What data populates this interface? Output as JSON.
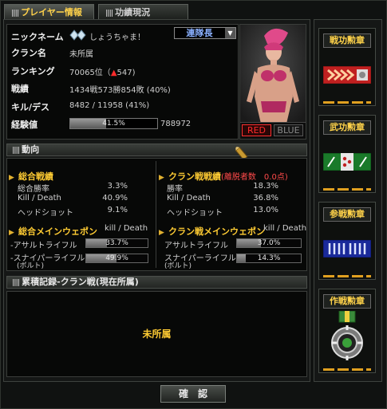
{
  "tabs": [
    {
      "label": "プレイヤー情報"
    },
    {
      "label": "功績現況"
    }
  ],
  "profile": {
    "nickname_label": "ニックネーム",
    "nickname": "しょうちゃま！",
    "clan_label": "クラン名",
    "clan": "未所属",
    "ranking_label": "ランキング",
    "ranking": "70065位（",
    "ranking_change": "547",
    "record_label": "戦績",
    "record": "1434戦573勝854敗 (40%)",
    "kd_label": "キル/デス",
    "kd": "8482 / 11958 (41%)",
    "exp_label": "経験値",
    "exp_percent_text": "41.5%",
    "exp_percent": 41.5,
    "exp_total": "788972"
  },
  "rank_select": {
    "selected": "連隊長"
  },
  "team_toggle": {
    "red": "RED",
    "blue": "BLUE"
  },
  "trend": {
    "header": "動向",
    "overall": {
      "title": "総合戦績",
      "rows": [
        {
          "label": "総合勝率",
          "value": "3.3%"
        },
        {
          "label": "Kill / Death",
          "value": "40.9%"
        },
        {
          "label": "ヘッドショット",
          "value": "9.1%"
        }
      ],
      "weapon_title": "総合メインウェポン",
      "weapon_kd": "kill / Death",
      "weapons": [
        {
          "label": "-アサルトライフル",
          "value": "33.7%",
          "percent": 33.7
        },
        {
          "label": "-スナイパーライフル",
          "label2": "(ボルト)",
          "value": "49.9%",
          "percent": 49.9
        }
      ]
    },
    "clan": {
      "title": "クラン戦戦績",
      "note": "(離脱者数　0.0点)",
      "rows": [
        {
          "label": "勝率",
          "value": "18.3%"
        },
        {
          "label": "Kill / Death",
          "value": "36.8%"
        },
        {
          "label": "ヘッドショット",
          "value": "13.0%"
        }
      ],
      "weapon_title": "クラン戦メインウェポン",
      "weapon_kd": "kill / Death",
      "weapons": [
        {
          "label": "アサルトライフル",
          "value": "37.0%",
          "percent": 37.0
        },
        {
          "label": "スナイパーライフル",
          "label2": "(ボルト)",
          "value": "14.3%",
          "percent": 14.3
        }
      ]
    }
  },
  "clan_history": {
    "header": "累積記録-クラン戦(現在所属)",
    "value": "未所属"
  },
  "medals": [
    {
      "title": "戦功勲章"
    },
    {
      "title": "武功勲章"
    },
    {
      "title": "参戦勲章"
    },
    {
      "title": "作戦勲章"
    }
  ],
  "confirm_label": "確　認",
  "colors": {
    "accent": "#ffcc33",
    "red_team": "#ff2b2b",
    "rank_up": "#ff2b2b",
    "medal_dash": "#e0a020"
  }
}
